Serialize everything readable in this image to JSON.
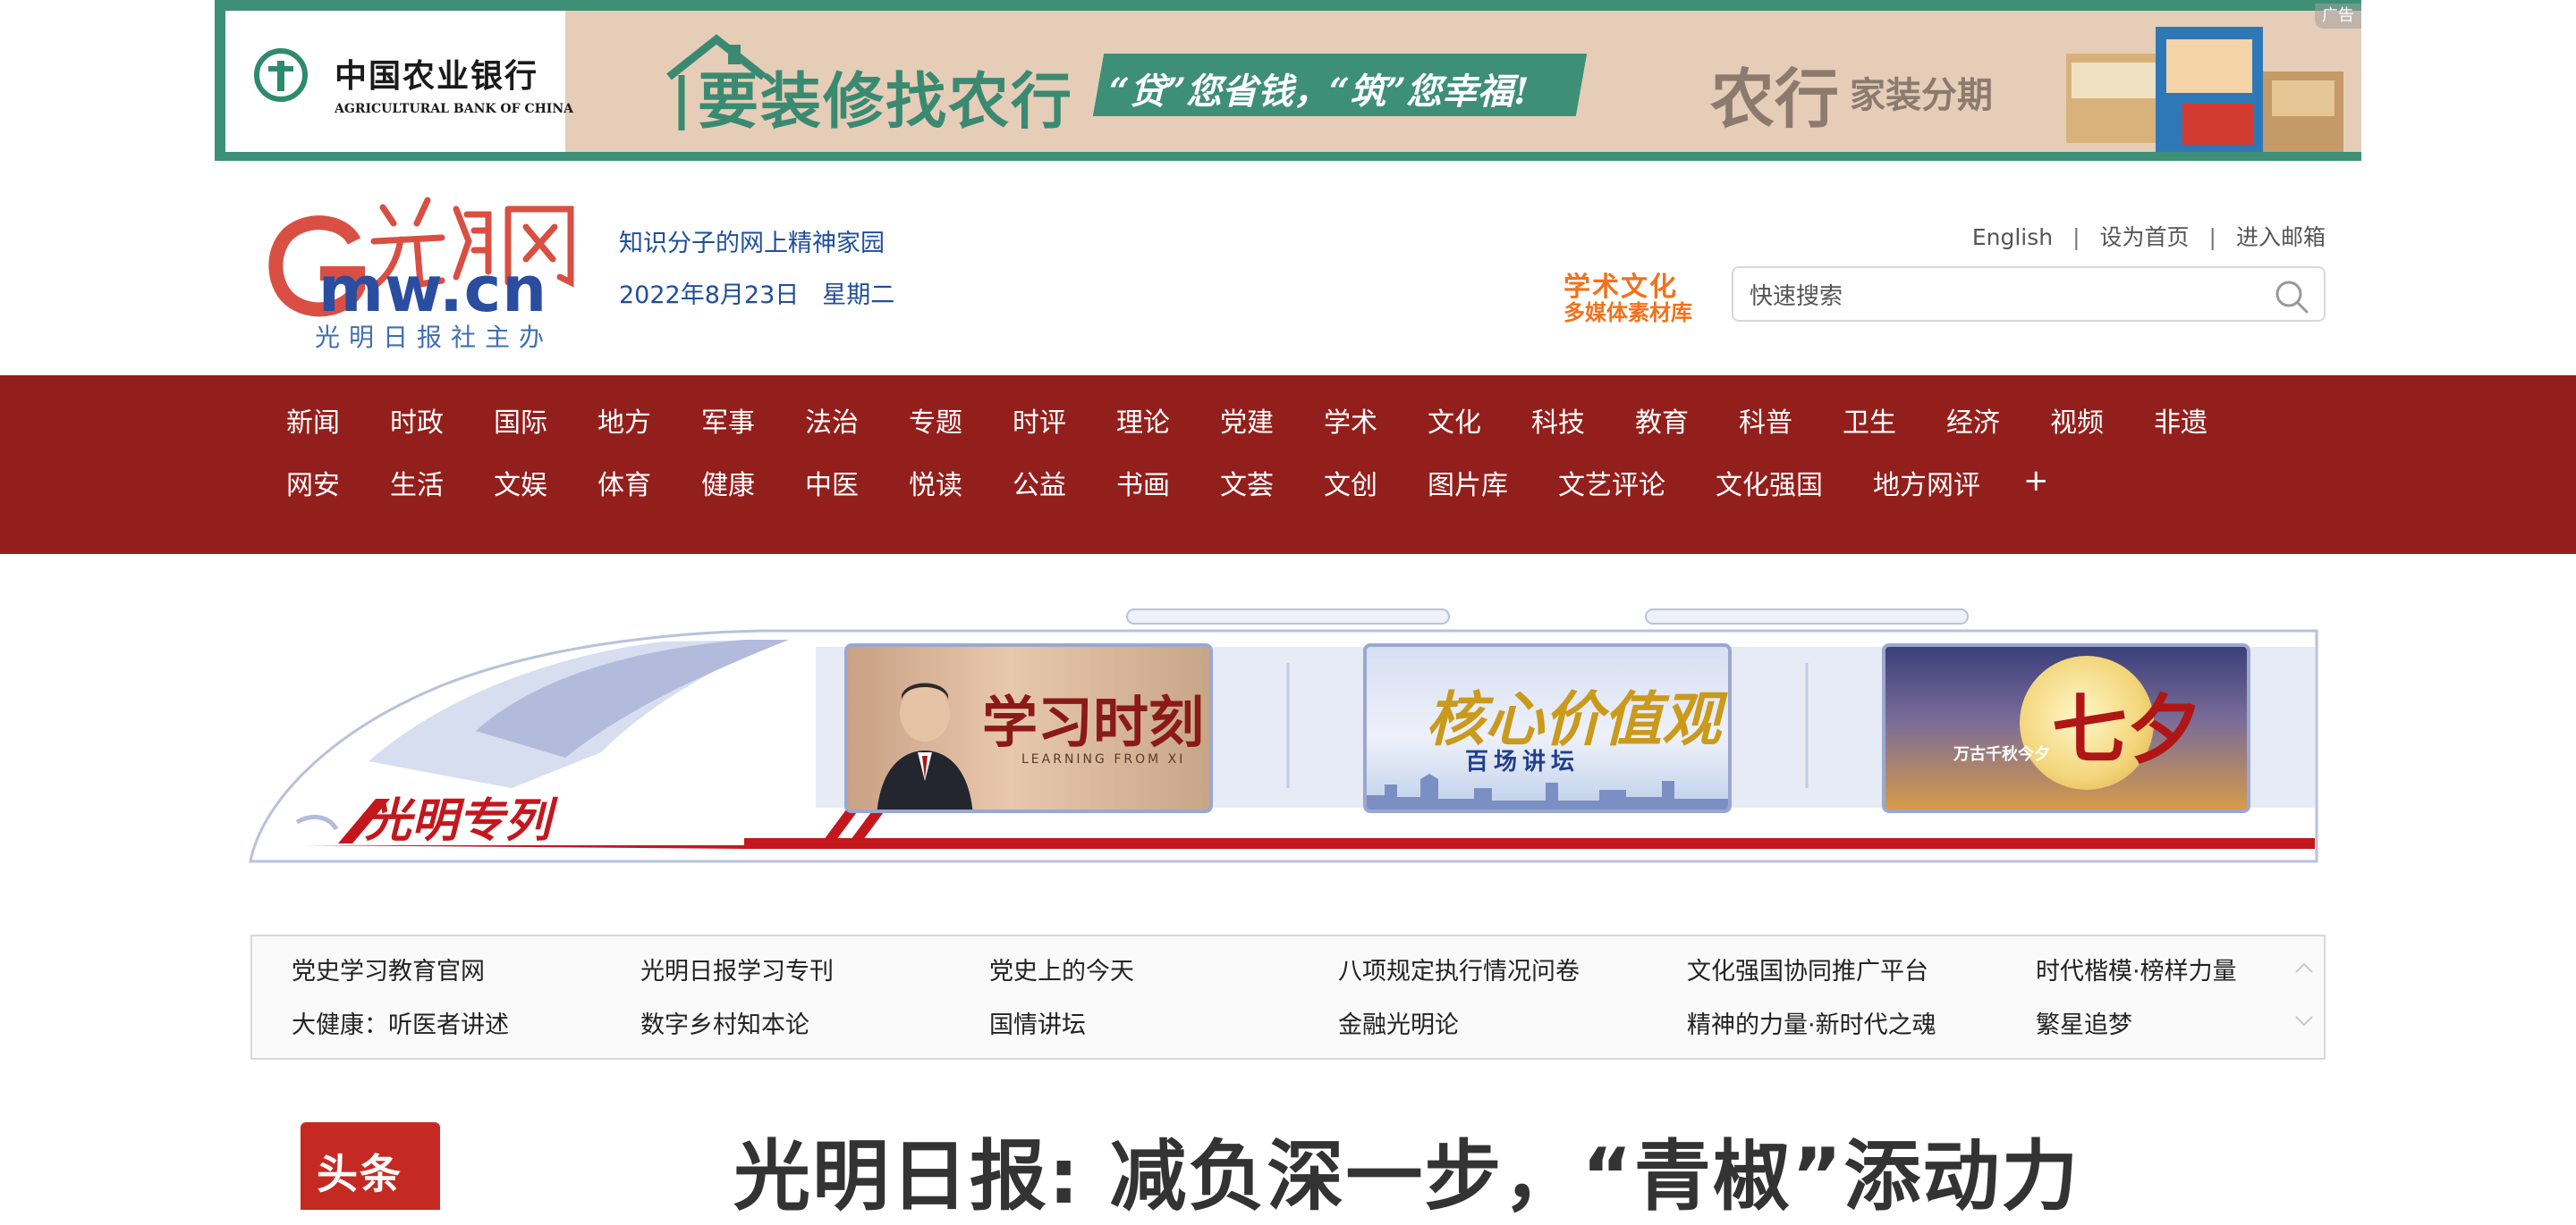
{
  "ad": {
    "bank_name_cn": "中国农业银行",
    "bank_name_en": "AGRICULTURAL BANK OF CHINA",
    "slogan_main": "要装修找农行",
    "slogan_sub": "“贷”您省钱，“筑”您幸福!",
    "product_brand": "农行",
    "product_name": "家装分期",
    "badge": "广告"
  },
  "header": {
    "logo_subtitle": "光明日报社主办",
    "tagline": "知识分子的网上精神家园",
    "date": "2022年8月23日",
    "weekday": "星期二",
    "top_links": [
      "English",
      "设为首页",
      "进入邮箱"
    ],
    "media_library_line1": "学术文化",
    "media_library_line2": "多媒体素材库",
    "search_placeholder": "快速搜索"
  },
  "nav": {
    "row1": [
      "新闻",
      "时政",
      "国际",
      "地方",
      "军事",
      "法治",
      "专题",
      "时评",
      "理论",
      "党建",
      "学术",
      "文化",
      "科技",
      "教育",
      "科普",
      "卫生",
      "经济",
      "视频",
      "非遗"
    ],
    "row2": [
      "网安",
      "生活",
      "文娱",
      "体育",
      "健康",
      "中医",
      "悦读",
      "公益",
      "书画",
      "文荟",
      "文创",
      "图片库",
      "文艺评论",
      "文化强国",
      "地方网评"
    ],
    "more": "+"
  },
  "train": {
    "label": "光明专列",
    "tiles": [
      {
        "title": "学习时刻",
        "subtitle": "LEARNING FROM XI"
      },
      {
        "title": "核心价值观",
        "subtitle": "百场讲坛"
      },
      {
        "title": "七夕",
        "subtitle": "万古千秋今夕"
      }
    ]
  },
  "links": {
    "items": [
      "党史学习教育官网",
      "光明日报学习专刊",
      "党史上的今天",
      "八项规定执行情况问卷",
      "文化强国协同推广平台",
      "时代楷模·榜样力量",
      "大健康：听医者讲述",
      "数字乡村知本论",
      "国情讲坛",
      "金融光明论",
      "精神的力量·新时代之魂",
      "繁星追梦"
    ]
  },
  "headline": {
    "stamp": "头条",
    "title": "光明日报: 减负深一步，“青椒”添动力"
  },
  "colors": {
    "nav_bg": "#931f1c",
    "ad_green": "#3d8f76",
    "brand_blue": "#1f4e9b",
    "accent_orange": "#f2711b",
    "train_red": "#c4171d"
  }
}
